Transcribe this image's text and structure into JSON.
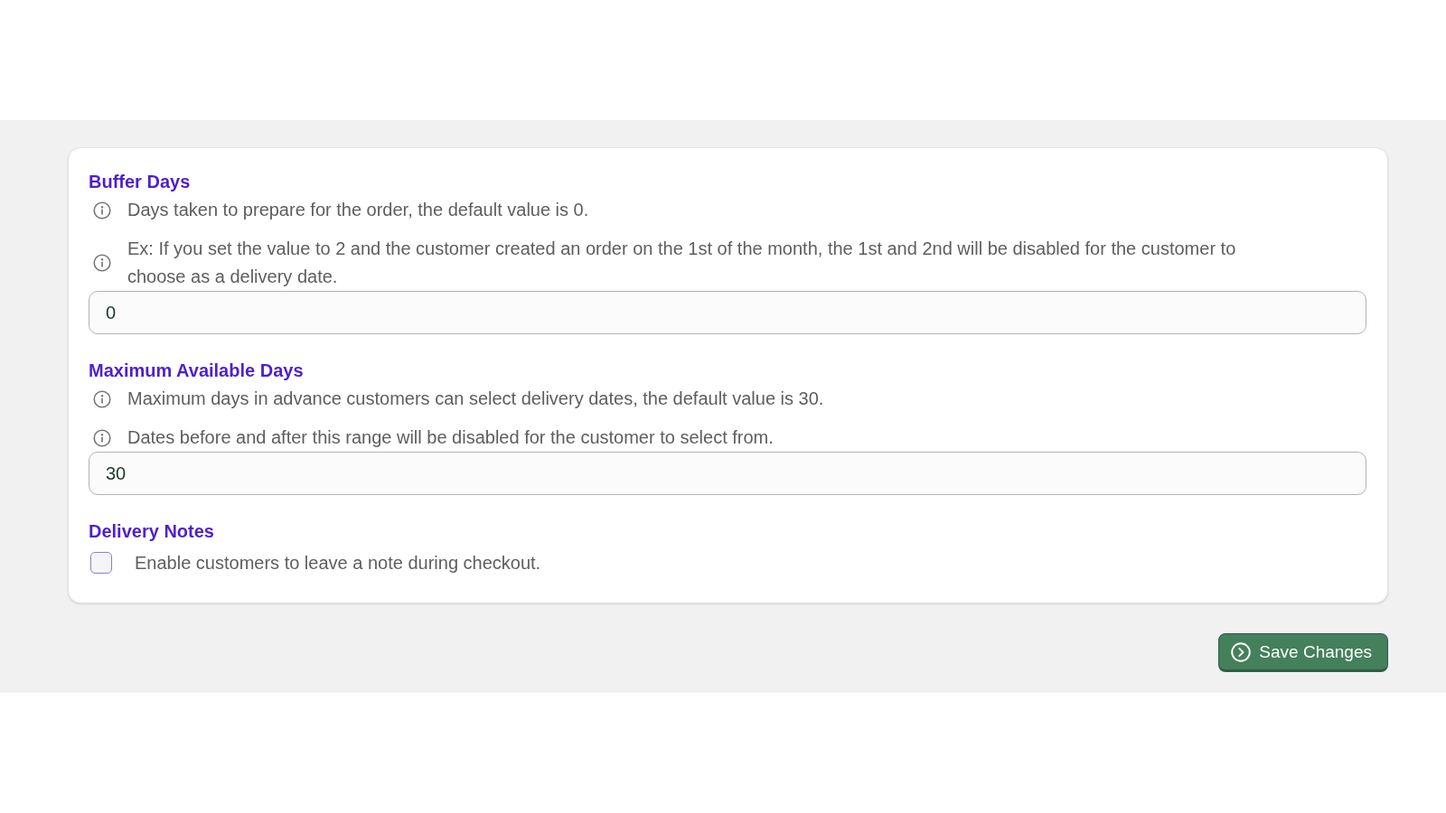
{
  "sections": [
    {
      "kind": "number",
      "title": "Buffer Days",
      "hints": [
        "Days taken to prepare for the order, the default value is 0.",
        "Ex: If you set the value to 2 and the customer created an order on the 1st of the month, the 1st and 2nd will be disabled for the customer to choose as a delivery date."
      ],
      "value": "0"
    },
    {
      "kind": "number",
      "title": "Maximum Available Days",
      "hints": [
        "Maximum days in advance customers can select delivery dates, the default value is 30.",
        "Dates before and after this range will be disabled for the customer to select from."
      ],
      "value": "30"
    },
    {
      "kind": "checkbox",
      "title": "Delivery Notes",
      "label": "Enable customers to leave a note during checkout.",
      "checked": false
    }
  ],
  "save_button": {
    "label": "Save Changes"
  }
}
